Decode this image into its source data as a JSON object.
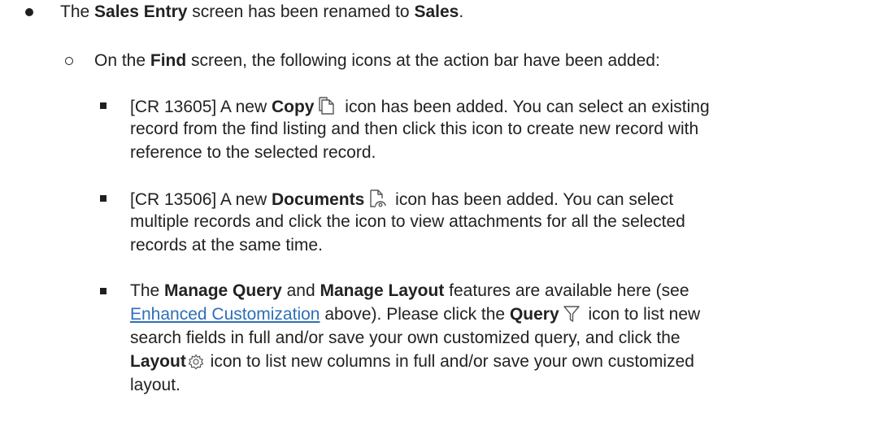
{
  "content": {
    "l1": {
      "t1": "The ",
      "b1": "Sales Entry",
      "t2": " screen has been renamed to ",
      "b2": "Sales",
      "t3": "."
    },
    "l2": {
      "t1": "On the ",
      "b1": "Find",
      "t2": " screen, the following icons at the action bar have been added:"
    },
    "copy_item": {
      "line1": {
        "t1": "[CR 13605] A new ",
        "b1": "Copy",
        "t2": " icon has been added. You can select an existing"
      },
      "line2": "record from the find listing and then click this icon to create new record with",
      "line3": "reference to the selected record.",
      "icon": "copy-icon"
    },
    "docs_item": {
      "line1": {
        "t1": "[CR 13506] A new ",
        "b1": "Documents",
        "t2": " icon has been added. You can select"
      },
      "line2": "multiple records and click the icon to view attachments for all the selected",
      "line3": "records at the same time.",
      "icon": "document-attachment-icon"
    },
    "manage_item": {
      "line1": {
        "t1": "The ",
        "b1": "Manage Query",
        "t2": " and ",
        "b2": "Manage Layout",
        "t3": " features are available here (see"
      },
      "line2": {
        "link": "Enhanced Customization",
        "t1": " above). Please click the ",
        "b1": "Query",
        "t2": " icon to list new"
      },
      "line3": "search fields in full and/or save your own customized query, and click the",
      "line4": {
        "b1": "Layout",
        "t1": " icon to list new columns in full and/or save your own customized"
      },
      "line5": "layout.",
      "query_icon": "filter-icon",
      "layout_icon": "gear-icon"
    },
    "link_color": "#2e6fb8"
  }
}
